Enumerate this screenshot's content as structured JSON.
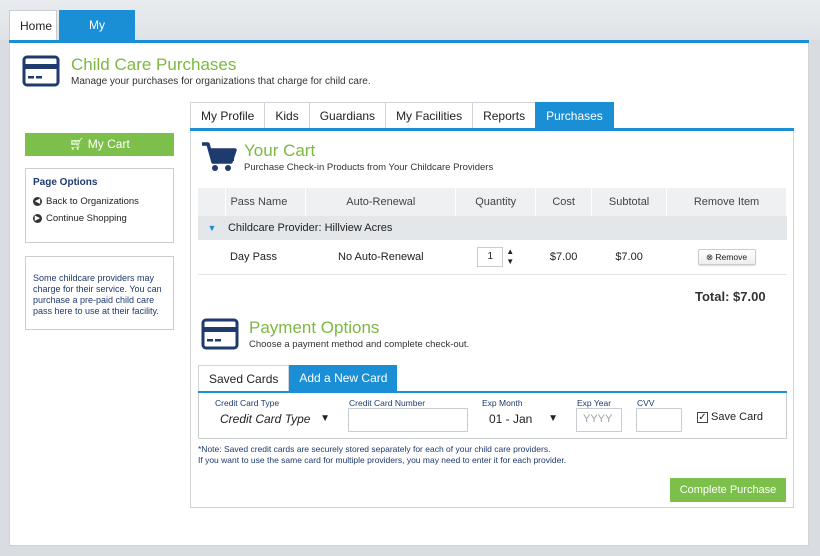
{
  "topnav": {
    "tabs": [
      {
        "label": "Home"
      },
      {
        "label": "My Account"
      }
    ]
  },
  "header": {
    "title": "Child Care Purchases",
    "subtitle": "Manage your purchases for organizations that charge for child care."
  },
  "sidebar": {
    "cart_label": "My Cart",
    "options_title": "Page Options",
    "options": [
      {
        "label": "Back to Organizations"
      },
      {
        "label": "Continue Shopping"
      }
    ],
    "info_text": "Some childcare providers may charge for their service. You can purchase a pre-paid child care pass here to use at their facility."
  },
  "subtabs": [
    {
      "label": "My Profile"
    },
    {
      "label": "Kids"
    },
    {
      "label": "Guardians"
    },
    {
      "label": "My Facilities"
    },
    {
      "label": "Reports"
    },
    {
      "label": "Purchases"
    }
  ],
  "cart": {
    "title": "Your Cart",
    "subtitle": "Purchase Check-in Products from Your Childcare Providers",
    "columns": [
      "Pass Name",
      "Auto-Renewal",
      "Quantity",
      "Cost",
      "Subtotal",
      "Remove Item"
    ],
    "provider": "Childcare Provider: Hillview Acres",
    "items": [
      {
        "pass_name": "Day Pass",
        "auto_renewal": "No Auto-Renewal",
        "quantity": "1",
        "cost": "$7.00",
        "subtotal": "$7.00",
        "remove_label": "Remove"
      }
    ],
    "total": "Total: $7.00"
  },
  "payment": {
    "title": "Payment Options",
    "subtitle": "Choose a payment method and complete check-out.",
    "tabs": [
      {
        "label": "Saved Cards"
      },
      {
        "label": "Add a New Card"
      }
    ],
    "fields": {
      "card_type_label": "Credit Card Type",
      "card_type_value": "Credit Card Type",
      "card_number_label": "Credit Card Number",
      "exp_month_label": "Exp Month",
      "exp_month_value": "01 - Jan",
      "exp_year_label": "Exp Year",
      "exp_year_placeholder": "YYYY",
      "cvv_label": "CVV",
      "save_card_label": "Save Card"
    },
    "note_line1": "*Note: Saved credit cards are securely stored separately for each of your child care providers.",
    "note_line2": "If you want to use the same card for multiple providers, you may need to enter it for each provider.",
    "complete_label": "Complete Purchase"
  },
  "colors": {
    "accent_blue": "#1a8fd6",
    "accent_green": "#7cbf4a",
    "title_green": "#7cb941",
    "dark_navy": "#1e3a6e"
  }
}
